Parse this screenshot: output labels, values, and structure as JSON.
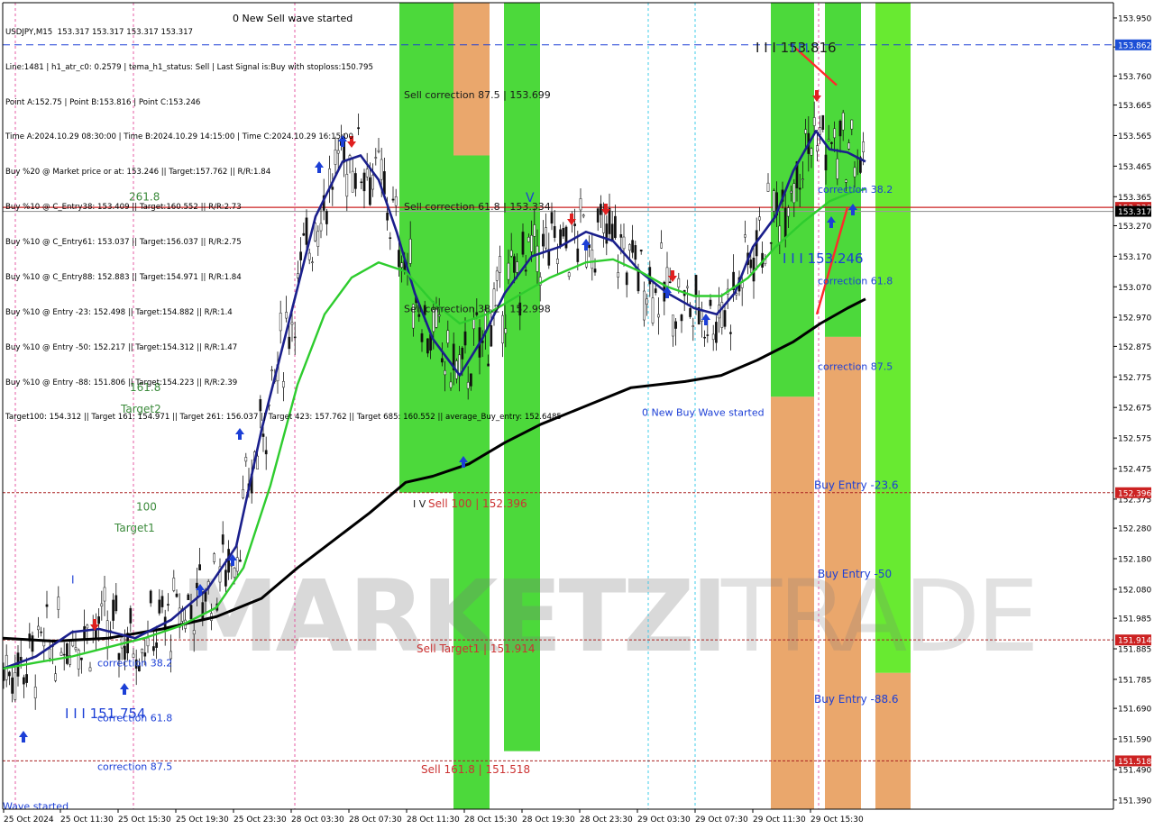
{
  "header": {
    "lines": [
      "USDJPY,M15  153.317 153.317 153.317 153.317",
      "Line:1481 | h1_atr_c0: 0.2579 | tema_h1_status: Sell | Last Signal is:Buy with stoploss:150.795",
      "Point A:152.75 | Point B:153.816 | Point C:153.246",
      "Time A:2024.10.29 08:30:00 | Time B:2024.10.29 14:15:00 | Time C:2024.10.29 16:15:00",
      "Buy %20 @ Market price or at: 153.246 || Target:157.762 || R/R:1.84",
      "Buy %10 @ C_Entry38: 153.409 || Target:160.552 || R/R:2.73",
      "Buy %10 @ C_Entry61: 153.037 || Target:156.037 || R/R:2.75",
      "Buy %10 @ C_Entry88: 152.883 || Target:154.971 || R/R:1.84",
      "Buy %10 @ Entry -23: 152.498 || Target:154.882 || R/R:1.4",
      "Buy %10 @ Entry -50: 152.217 || Target:154.312 || R/R:1.47",
      "Buy %10 @ Entry -88: 151.806 || Target:154.223 || R/R:2.39",
      "Target100: 154.312 || Target 161: 154.971 || Target 261: 156.037 || Target 423: 157.762 || Target 685: 160.552 || average_Buy_entry: 152.6485"
    ]
  },
  "chart_data": {
    "type": "line",
    "symbol": "USDJPY",
    "timeframe": "M15",
    "last_price": "153.317",
    "ylim": [
      151.36,
      154.0
    ],
    "y_ticks": [
      "153.950",
      "153.855",
      "153.760",
      "153.665",
      "153.565",
      "153.465",
      "153.365",
      "153.270",
      "153.170",
      "153.070",
      "152.970",
      "152.875",
      "152.775",
      "152.675",
      "152.575",
      "152.475",
      "152.375",
      "152.280",
      "152.180",
      "152.080",
      "151.985",
      "151.885",
      "151.785",
      "151.690",
      "151.590",
      "151.490",
      "151.390"
    ],
    "x_ticks": [
      "25 Oct 2024",
      "25 Oct 11:30",
      "25 Oct 15:30",
      "25 Oct 19:30",
      "25 Oct 23:30",
      "28 Oct 03:30",
      "28 Oct 07:30",
      "28 Oct 11:30",
      "28 Oct 15:30",
      "28 Oct 19:30",
      "28 Oct 23:30",
      "29 Oct 03:30",
      "29 Oct 07:30",
      "29 Oct 11:30",
      "29 Oct 15:30"
    ],
    "price_tags": [
      {
        "value": 153.862,
        "label": "153.862",
        "bg": "#1c4fd6"
      },
      {
        "value": 153.33,
        "label": "153.330",
        "bg": "#cc2222"
      },
      {
        "value": 153.317,
        "label": "153.317",
        "bg": "#000000"
      },
      {
        "value": 152.396,
        "label": "152.396",
        "bg": "#cc2222"
      },
      {
        "value": 151.914,
        "label": "151.914",
        "bg": "#cc2222"
      },
      {
        "value": 151.518,
        "label": "151.518",
        "bg": "#cc2222"
      }
    ],
    "h_lines": [
      {
        "value": 153.862,
        "color": "#1c3fd6",
        "style": "dashed"
      },
      {
        "value": 153.33,
        "color": "#cc2222",
        "style": "solid"
      },
      {
        "value": 153.317,
        "color": "#999999",
        "style": "solid"
      },
      {
        "value": 152.396,
        "color": "#aa2222",
        "style": "dotted"
      },
      {
        "value": 151.914,
        "color": "#aa2222",
        "style": "dotted"
      },
      {
        "value": 151.518,
        "color": "#aa2222",
        "style": "dotted"
      }
    ],
    "zones": [
      {
        "color": "#3dd62a",
        "top": 154.0,
        "bottom": 152.396
      },
      {
        "color": "#e8a060",
        "top": 154.0,
        "bottom": 153.5
      },
      {
        "color": "#3dd62a",
        "top": 153.5,
        "bottom": 151.36
      },
      {
        "color": "#3dd62a",
        "top": 154.0,
        "bottom": 151.55
      },
      {
        "color": "#3dd62a",
        "top": 154.0,
        "bottom": 152.71
      },
      {
        "color": "#e8a060",
        "top": 152.71,
        "bottom": 151.36
      },
      {
        "color": "#3dd62a",
        "top": 154.0,
        "bottom": 152.906
      },
      {
        "color": "#e8a060",
        "top": 152.906,
        "bottom": 151.36
      },
      {
        "color": "#5be820",
        "top": 154.0,
        "bottom": 151.806
      },
      {
        "color": "#e8a060",
        "top": 151.806,
        "bottom": 151.36
      }
    ],
    "labels": [
      {
        "text": "0 New Sell wave started",
        "value": 153.95,
        "color": "#000000"
      },
      {
        "text": "Sell correction 87.5 | 153.699",
        "value": 153.699,
        "color": "#1a1a1a"
      },
      {
        "text": "Sell correction 61.8 | 153.334",
        "value": 153.334,
        "color": "#1a1a1a"
      },
      {
        "text": "Sell correction 38.2 | 152.998",
        "value": 152.998,
        "color": "#1a1a1a"
      },
      {
        "text": "I V",
        "value": 152.36,
        "color": "#1a1a1a"
      },
      {
        "text": "Sell 100 | 152.396",
        "value": 152.36,
        "color": "#cc3333"
      },
      {
        "text": "Sell Target1 | 151.914",
        "value": 151.885,
        "color": "#cc3333"
      },
      {
        "text": "Sell 161.8 | 151.518",
        "value": 151.49,
        "color": "#cc3333"
      },
      {
        "text": "261.8",
        "value": 153.365,
        "color": "#3b8a3b"
      },
      {
        "text": "161.8",
        "value": 152.74,
        "color": "#3b8a3b"
      },
      {
        "text": "Target2",
        "value": 152.67,
        "color": "#3b8a3b"
      },
      {
        "text": "100",
        "value": 152.35,
        "color": "#3b8a3b"
      },
      {
        "text": "Target1",
        "value": 152.28,
        "color": "#3b8a3b"
      },
      {
        "text": "I I I 153.816",
        "value": 153.85,
        "color": "#1a1a1a"
      },
      {
        "text": "I I I",
        "value": 153.85,
        "color": "#1c3fd6"
      },
      {
        "text": "I I I 153.246",
        "value": 153.16,
        "color": "#1c3fd6"
      },
      {
        "text": "correction 38.2",
        "value": 153.39,
        "color": "#1c3fd6"
      },
      {
        "text": "correction 61.8",
        "value": 153.09,
        "color": "#1c3fd6"
      },
      {
        "text": "correction 87.5",
        "value": 152.81,
        "color": "#1c3fd6"
      },
      {
        "text": "0 New Buy Wave started",
        "value": 152.66,
        "color": "#1c3fd6"
      },
      {
        "text": "Buy Entry -23.6",
        "value": 152.42,
        "color": "#1c3fd6"
      },
      {
        "text": "Buy Entry -50",
        "value": 152.13,
        "color": "#1c3fd6"
      },
      {
        "text": "Buy Entry -88.6",
        "value": 151.72,
        "color": "#1c3fd6"
      },
      {
        "text": "correction 38.2",
        "value": 151.84,
        "color": "#1c3fd6"
      },
      {
        "text": "I I I 151.754",
        "value": 151.67,
        "color": "#1c3fd6"
      },
      {
        "text": "correction 61.8",
        "value": 151.66,
        "color": "#1c3fd6"
      },
      {
        "text": "correction 87.5",
        "value": 151.5,
        "color": "#1c3fd6"
      },
      {
        "text": "I",
        "value": 152.11,
        "color": "#1c3fd6"
      },
      {
        "text": "V",
        "value": 153.36,
        "color": "#1c3fd6"
      },
      {
        "text": "Wave started",
        "value": 151.37,
        "color": "#1c3fd6"
      }
    ],
    "watermark": {
      "part1": "MARKETZI",
      "part2": "TRADE"
    },
    "series": [
      {
        "name": "",
        "color": "#000000",
        "values": [
          [
            3,
            151.92
          ],
          [
            60,
            151.91
          ],
          [
            120,
            151.92
          ],
          [
            180,
            151.95
          ],
          [
            240,
            151.99
          ],
          [
            290,
            152.05
          ],
          [
            330,
            152.15
          ],
          [
            370,
            152.24
          ],
          [
            410,
            152.33
          ],
          [
            450,
            152.43
          ],
          [
            480,
            152.45
          ],
          [
            520,
            152.49
          ],
          [
            560,
            152.56
          ],
          [
            600,
            152.62
          ],
          [
            650,
            152.68
          ],
          [
            700,
            152.74
          ],
          [
            760,
            152.76
          ],
          [
            800,
            152.78
          ],
          [
            840,
            152.83
          ],
          [
            880,
            152.89
          ],
          [
            910,
            152.95
          ],
          [
            940,
            153.0
          ],
          [
            960,
            153.03
          ]
        ]
      },
      {
        "name": "",
        "color": "#1a1f8c",
        "values": [
          [
            3,
            151.82
          ],
          [
            40,
            151.86
          ],
          [
            80,
            151.94
          ],
          [
            110,
            151.95
          ],
          [
            150,
            151.92
          ],
          [
            190,
            151.98
          ],
          [
            230,
            152.08
          ],
          [
            262,
            152.22
          ],
          [
            290,
            152.6
          ],
          [
            320,
            152.95
          ],
          [
            350,
            153.3
          ],
          [
            380,
            153.48
          ],
          [
            400,
            153.5
          ],
          [
            420,
            153.42
          ],
          [
            440,
            153.25
          ],
          [
            460,
            153.05
          ],
          [
            480,
            152.9
          ],
          [
            510,
            152.78
          ],
          [
            535,
            152.9
          ],
          [
            560,
            153.05
          ],
          [
            590,
            153.17
          ],
          [
            620,
            153.2
          ],
          [
            650,
            153.25
          ],
          [
            680,
            153.22
          ],
          [
            710,
            153.12
          ],
          [
            740,
            153.05
          ],
          [
            770,
            153.0
          ],
          [
            795,
            152.98
          ],
          [
            815,
            153.05
          ],
          [
            835,
            153.2
          ],
          [
            860,
            153.3
          ],
          [
            880,
            153.45
          ],
          [
            905,
            153.58
          ],
          [
            920,
            153.52
          ],
          [
            940,
            153.51
          ],
          [
            960,
            153.48
          ]
        ]
      },
      {
        "name": "",
        "color": "#2ecc2e",
        "values": [
          [
            3,
            151.82
          ],
          [
            40,
            151.84
          ],
          [
            80,
            151.86
          ],
          [
            120,
            151.89
          ],
          [
            160,
            151.92
          ],
          [
            200,
            151.96
          ],
          [
            240,
            152.02
          ],
          [
            270,
            152.15
          ],
          [
            300,
            152.42
          ],
          [
            330,
            152.75
          ],
          [
            360,
            152.98
          ],
          [
            390,
            153.1
          ],
          [
            420,
            153.15
          ],
          [
            450,
            153.12
          ],
          [
            480,
            153.02
          ],
          [
            510,
            152.95
          ],
          [
            540,
            152.98
          ],
          [
            580,
            153.05
          ],
          [
            610,
            153.1
          ],
          [
            650,
            153.15
          ],
          [
            680,
            153.16
          ],
          [
            710,
            153.12
          ],
          [
            740,
            153.07
          ],
          [
            770,
            153.04
          ],
          [
            800,
            153.04
          ],
          [
            830,
            153.1
          ],
          [
            860,
            153.2
          ],
          [
            890,
            153.28
          ],
          [
            920,
            153.35
          ],
          [
            945,
            153.38
          ],
          [
            960,
            153.39
          ]
        ]
      },
      {
        "name": "",
        "color": "#ff2a2a",
        "values": [
          [
            883,
            153.85
          ],
          [
            928,
            153.73
          ]
        ]
      },
      {
        "name": "",
        "color": "#ff2a2a",
        "values": [
          [
            906,
            152.98
          ],
          [
            940,
            153.33
          ]
        ]
      }
    ]
  }
}
